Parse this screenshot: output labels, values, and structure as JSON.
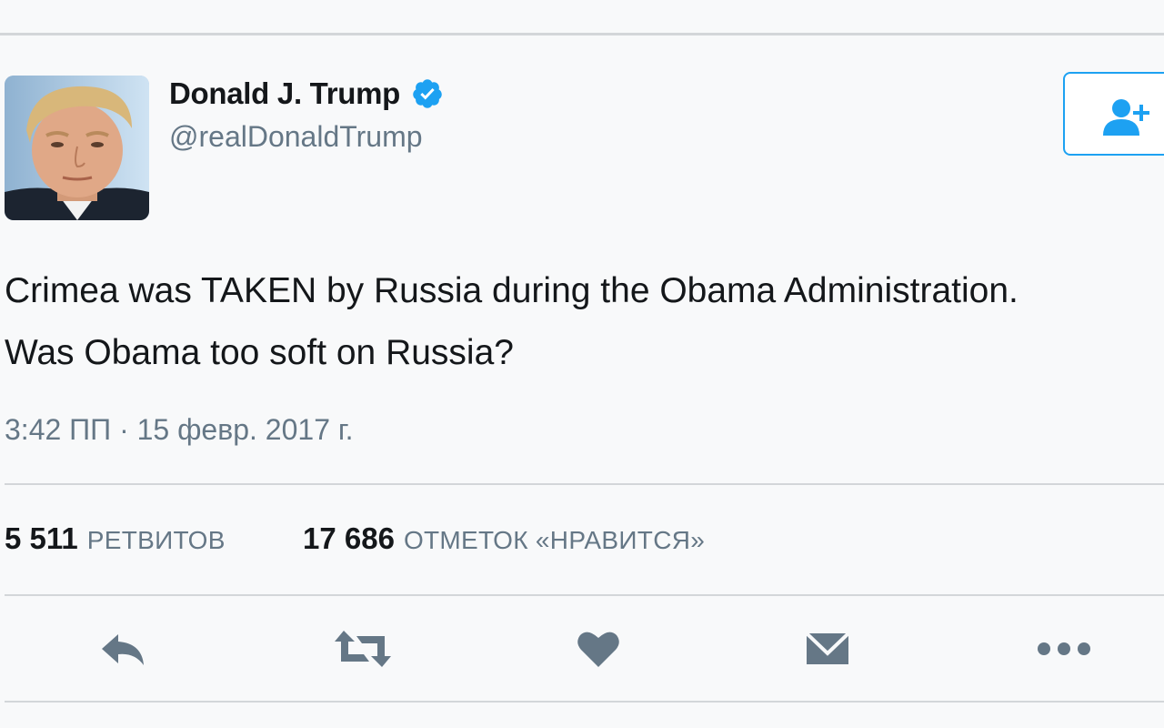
{
  "user": {
    "display_name": "Donald J. Trump",
    "handle": "@realDonaldTrump",
    "verified": true,
    "avatar_icon": "profile-photo"
  },
  "follow_button": {
    "icon": "add-user-icon"
  },
  "tweet": {
    "lines": [
      "Crimea was TAKEN by Russia during the Obama Administration.",
      "Was Obama too soft on Russia?"
    ],
    "timestamp": "3:42 ПП · 15 февр. 2017 г."
  },
  "stats": {
    "retweets_count": "5 511",
    "retweets_label": "РЕТВИТОВ",
    "likes_count": "17 686",
    "likes_label": "ОТМЕТОК «НРАВИТСЯ»"
  },
  "actions": [
    {
      "icon": "reply-icon"
    },
    {
      "icon": "retweet-icon"
    },
    {
      "icon": "heart-icon"
    },
    {
      "icon": "direct-message-icon"
    },
    {
      "icon": "more-icon"
    }
  ],
  "colors": {
    "accent": "#1da1f2",
    "icon_gray": "#657786",
    "text": "#14171a",
    "divider": "#d3d6d9",
    "background": "#f8f9fa"
  }
}
